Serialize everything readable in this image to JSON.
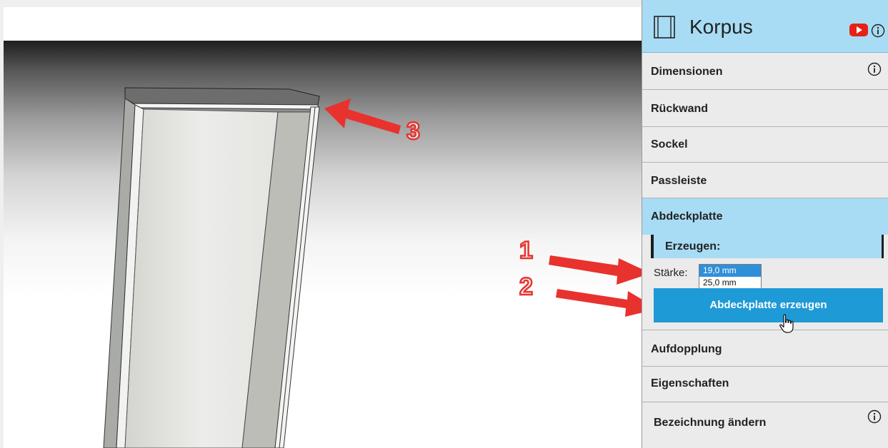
{
  "panel": {
    "title": "Korpus",
    "sections": [
      {
        "label": "Dimensionen",
        "info": true
      },
      {
        "label": "Rückwand"
      },
      {
        "label": "Sockel"
      },
      {
        "label": "Passleiste"
      },
      {
        "label": "Abdeckplatte",
        "active": true
      },
      {
        "label": "Aufdopplung"
      },
      {
        "label": "Eigenschaften"
      },
      {
        "label": "Bezeichnung ändern",
        "info": true
      }
    ],
    "abdeckplatte": {
      "sub_header": "Erzeugen:",
      "staerke_label": "Stärke:",
      "staerke_options": [
        "19,0 mm",
        "25,0 mm"
      ],
      "staerke_selected": "19,0 mm",
      "create_button": "Abdeckplatte erzeugen"
    }
  },
  "annotations": {
    "labels": [
      "1",
      "2",
      "3"
    ],
    "arrow_color": "#e8322e"
  },
  "icons": {
    "header_left": "cabinet-icon",
    "header_video": "youtube-icon",
    "header_info": "info-icon",
    "cursor": "hand-pointer-icon"
  },
  "colors": {
    "accent": "#a8dcf5",
    "button": "#1e9ad7",
    "panel_bg": "#ebebeb",
    "youtube_red": "#e62117"
  }
}
